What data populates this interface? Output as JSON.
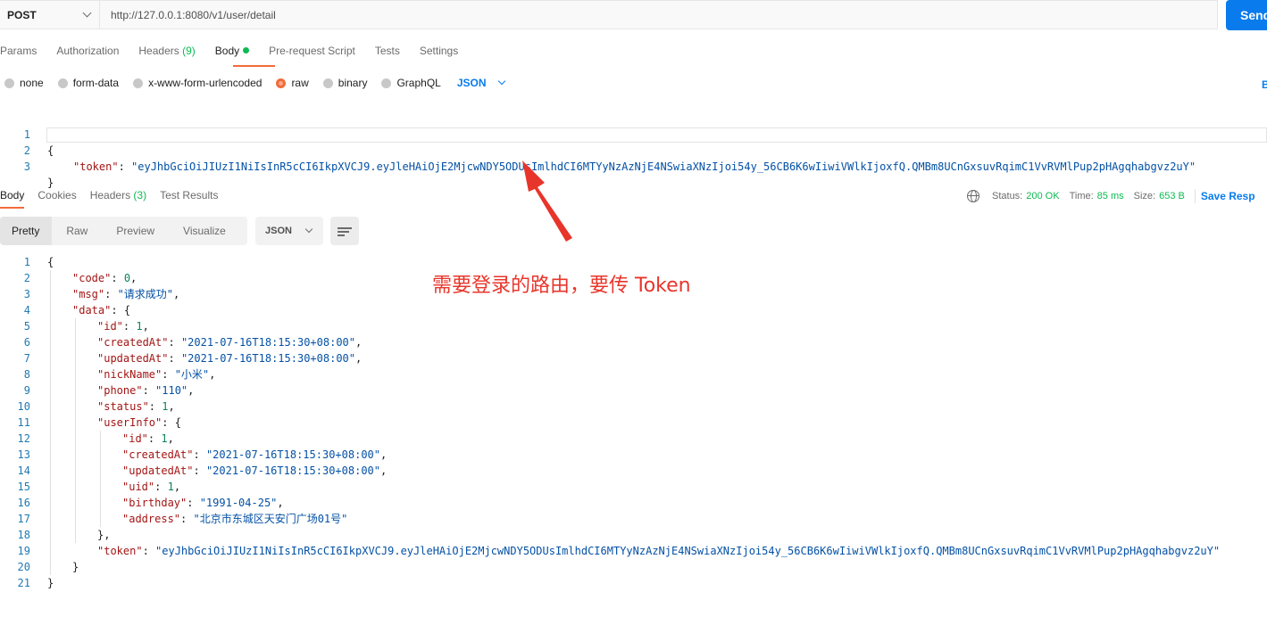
{
  "request": {
    "method": "POST",
    "url": "http://127.0.0.1:8080/v1/user/detail",
    "send_label": "Send"
  },
  "request_tabs": [
    {
      "label": "Params"
    },
    {
      "label": "Authorization"
    },
    {
      "label": "Headers",
      "count": "(9)"
    },
    {
      "label": "Body"
    },
    {
      "label": "Pre-request Script"
    },
    {
      "label": "Tests"
    },
    {
      "label": "Settings"
    }
  ],
  "body_types": [
    "none",
    "form-data",
    "x-www-form-urlencoded",
    "raw",
    "binary",
    "GraphQL"
  ],
  "body_format": "JSON",
  "edge_text": "B",
  "request_body": [
    {
      "n": "1",
      "text": "{"
    },
    {
      "n": "2",
      "key": "\"token\"",
      "value": "\"eyJhbGciOiJIUzI1NiIsInR5cCI6IkpXVCJ9.eyJleHAiOjE2MjcwNDY5ODUsImlhdCI6MTYyNzAzNjE4NSwiaXNzIjoi54y_56CB6K6wIiwiVWlkIjoxfQ.QMBm8UCnGxsuvRqimC1VvRVMlPup2pHAgqhabgvz2uY\""
    },
    {
      "n": "3",
      "text": "}"
    }
  ],
  "response_tabs": [
    {
      "label": "Body"
    },
    {
      "label": "Cookies"
    },
    {
      "label": "Headers",
      "count": "(3)"
    },
    {
      "label": "Test Results"
    }
  ],
  "status": {
    "status_label": "Status:",
    "status_value": "200 OK",
    "time_label": "Time:",
    "time_value": "85 ms",
    "size_label": "Size:",
    "size_value": "653 B",
    "save_label": "Save Resp"
  },
  "view_modes": [
    "Pretty",
    "Raw",
    "Preview",
    "Visualize"
  ],
  "response_format": "JSON",
  "response_body": [
    {
      "n": "1",
      "indent": 0,
      "text": "{"
    },
    {
      "n": "2",
      "indent": 1,
      "key": "\"code\"",
      "num": "0",
      "comma": ","
    },
    {
      "n": "3",
      "indent": 1,
      "key": "\"msg\"",
      "str": "\"请求成功\"",
      "comma": ","
    },
    {
      "n": "4",
      "indent": 1,
      "key": "\"data\"",
      "open": "{"
    },
    {
      "n": "5",
      "indent": 2,
      "key": "\"id\"",
      "num": "1",
      "comma": ","
    },
    {
      "n": "6",
      "indent": 2,
      "key": "\"createdAt\"",
      "str": "\"2021-07-16T18:15:30+08:00\"",
      "comma": ","
    },
    {
      "n": "7",
      "indent": 2,
      "key": "\"updatedAt\"",
      "str": "\"2021-07-16T18:15:30+08:00\"",
      "comma": ","
    },
    {
      "n": "8",
      "indent": 2,
      "key": "\"nickName\"",
      "str": "\"小米\"",
      "comma": ","
    },
    {
      "n": "9",
      "indent": 2,
      "key": "\"phone\"",
      "str": "\"110\"",
      "comma": ","
    },
    {
      "n": "10",
      "indent": 2,
      "key": "\"status\"",
      "num": "1",
      "comma": ","
    },
    {
      "n": "11",
      "indent": 2,
      "key": "\"userInfo\"",
      "open": "{"
    },
    {
      "n": "12",
      "indent": 3,
      "key": "\"id\"",
      "num": "1",
      "comma": ","
    },
    {
      "n": "13",
      "indent": 3,
      "key": "\"createdAt\"",
      "str": "\"2021-07-16T18:15:30+08:00\"",
      "comma": ","
    },
    {
      "n": "14",
      "indent": 3,
      "key": "\"updatedAt\"",
      "str": "\"2021-07-16T18:15:30+08:00\"",
      "comma": ","
    },
    {
      "n": "15",
      "indent": 3,
      "key": "\"uid\"",
      "num": "1",
      "comma": ","
    },
    {
      "n": "16",
      "indent": 3,
      "key": "\"birthday\"",
      "str": "\"1991-04-25\"",
      "comma": ","
    },
    {
      "n": "17",
      "indent": 3,
      "key": "\"address\"",
      "str": "\"北京市东城区天安门广场01号\""
    },
    {
      "n": "18",
      "indent": 2,
      "text": "},"
    },
    {
      "n": "19",
      "indent": 2,
      "key": "\"token\"",
      "str": "\"eyJhbGciOiJIUzI1NiIsInR5cCI6IkpXVCJ9.eyJleHAiOjE2MjcwNDY5ODUsImlhdCI6MTYyNzAzNjE4NSwiaXNzIjoi54y_56CB6K6wIiwiVWlkIjoxfQ.QMBm8UCnGxsuvRqimC1VvRVMlPup2pHAgqhabgvz2uY\""
    },
    {
      "n": "20",
      "indent": 1,
      "text": "}"
    },
    {
      "n": "21",
      "indent": 0,
      "text": "}"
    }
  ],
  "annotation": "需要登录的路由，要传 Token",
  "colors": {
    "accent": "#f26b3a",
    "link": "#097bed",
    "ok": "#0cbb52",
    "annotation": "#e8352b"
  }
}
